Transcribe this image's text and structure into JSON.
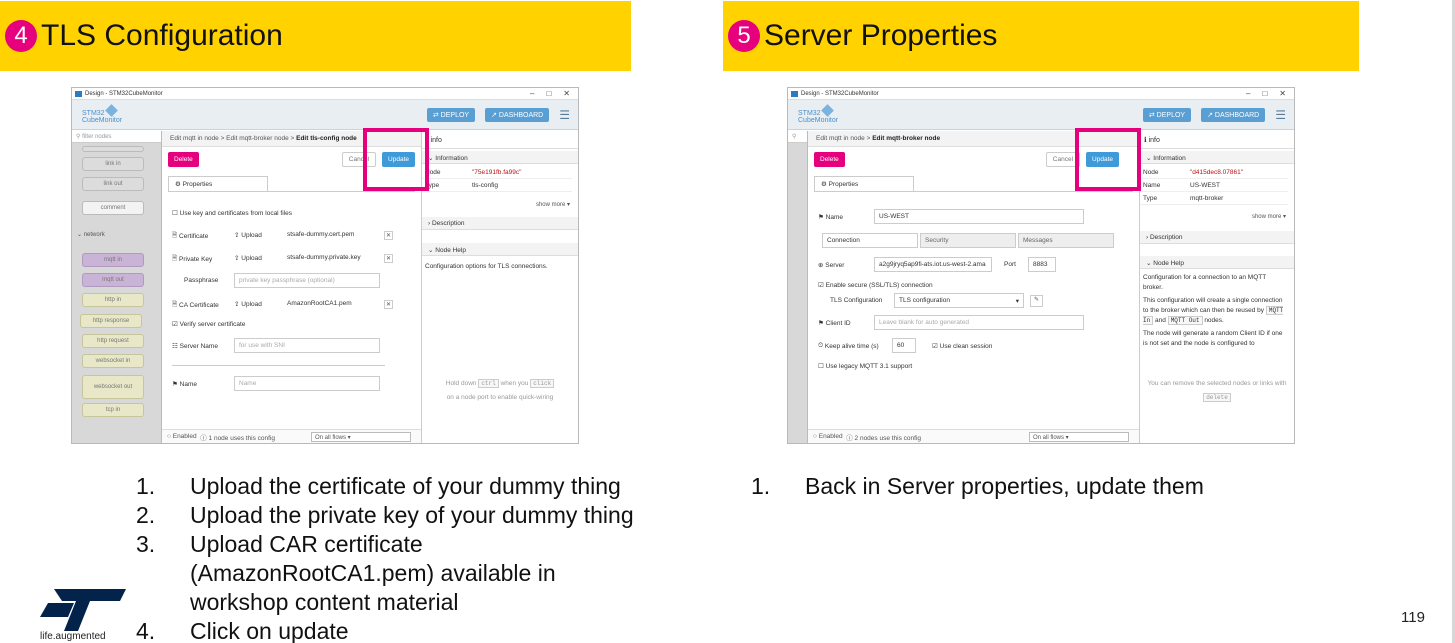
{
  "left": {
    "badge": "4",
    "title": "TLS Configuration",
    "window": {
      "title": "Design - STM32CubeMonitor",
      "logo_line1": "STM32",
      "logo_line2": "CubeMonitor",
      "deploy": "DEPLOY",
      "dashboard": "DASHBOARD",
      "filter": "filter nodes",
      "palette": [
        "link in",
        "link out",
        "comment",
        "network",
        "mqtt in",
        "mqtt out",
        "http in",
        "http response",
        "http request",
        "websocket in",
        "websocket out",
        "tcp in"
      ],
      "breadcrumb_prefix": "Edit mqtt in node > Edit mqtt-broker node > ",
      "breadcrumb_current": "Edit tls-config node",
      "delete": "Delete",
      "cancel": "Cancel",
      "update": "Update",
      "properties_tab": "Properties",
      "use_local": "Use key and certificates from local files",
      "cert_label": "Certificate",
      "upload": "Upload",
      "cert_file": "stsafe-dummy.cert.pem",
      "key_label": "Private Key",
      "key_file": "stsafe-dummy.private.key",
      "pass_label": "Passphrase",
      "pass_placeholder": "private key passphrase (optional)",
      "ca_label": "CA Certificate",
      "ca_file": "AmazonRootCA1.pem",
      "verify": "Verify server certificate",
      "servername_label": "Server Name",
      "servername_placeholder": "for use with SNI",
      "name_label": "Name",
      "name_placeholder": "Name",
      "enabled": "Enabled",
      "usage": "1 node uses this config",
      "flows": "On all flows",
      "info_tab": "info",
      "information": "Information",
      "node_key": "Node",
      "node_val": "\"75e191fb.fa99c\"",
      "type_key": "Type",
      "type_val": "tls-config",
      "show_more": "show more",
      "description": "Description",
      "node_help": "Node Help",
      "help_text": "Configuration options for TLS connections.",
      "hint_a": "Hold down",
      "hint_key1": "ctrl",
      "hint_b": "when you",
      "hint_key2": "click",
      "hint_c": "on a node port to enable quick-wiring"
    },
    "steps": [
      {
        "n": "1.",
        "text": "Upload the certificate of your dummy thing"
      },
      {
        "n": "2.",
        "text": "Upload the private key of your dummy thing"
      },
      {
        "n": "3.",
        "text": "Upload CAR certificate (AmazonRootCA1.pem) available in workshop content material"
      },
      {
        "n": "4.",
        "text": "Click on update"
      }
    ]
  },
  "right": {
    "badge": "5",
    "title": "Server Properties",
    "window": {
      "title": "Design - STM32CubeMonitor",
      "breadcrumb_prefix": "Edit mqtt in node > ",
      "breadcrumb_current": "Edit mqtt-broker node",
      "delete": "Delete",
      "cancel": "Cancel",
      "update": "Update",
      "properties_tab": "Properties",
      "name_label": "Name",
      "name_value": "US-WEST",
      "tab_connection": "Connection",
      "tab_security": "Security",
      "tab_messages": "Messages",
      "server_label": "Server",
      "server_value": "a2g9jryq5ap9fi-ats.iot.us-west-2.ama",
      "port_label": "Port",
      "port_value": "8883",
      "enable_tls": "Enable secure (SSL/TLS) connection",
      "tls_config_label": "TLS Configuration",
      "tls_config_value": "TLS configuration",
      "client_id_label": "Client ID",
      "client_id_placeholder": "Leave blank for auto generated",
      "keepalive_label": "Keep alive time (s)",
      "keepalive_value": "60",
      "clean_session": "Use clean session",
      "legacy": "Use legacy MQTT 3.1 support",
      "enabled": "Enabled",
      "usage": "2 nodes use this config",
      "flows": "On all flows",
      "info_tab": "info",
      "information": "Information",
      "node_key": "Node",
      "node_val": "\"d415dec8.07861\"",
      "name_key": "Name",
      "name_val": "US-WEST",
      "type_key": "Type",
      "type_val": "mqtt-broker",
      "show_more": "show more",
      "description": "Description",
      "node_help": "Node Help",
      "help1": "Configuration for a connection to an MQTT broker.",
      "help2a": "This configuration will create a single connection to the broker which can then be reused by",
      "help2_code1": "MQTT In",
      "help2_and": "and",
      "help2_code2": "MQTT Out",
      "help2b": "nodes.",
      "help3": "The node will generate a random Client ID if one is not set and the node is configured to",
      "hint_a": "You can remove the selected nodes or links with",
      "hint_key": "delete"
    },
    "steps": [
      {
        "n": "1.",
        "text": "Back in Server properties, update them"
      }
    ]
  },
  "footer": {
    "tagline": "life.augmented",
    "page_number": "119"
  },
  "colors": {
    "banner": "#ffd200",
    "badge": "#e6007e",
    "highlight": "#e6007e",
    "update_button": "#3e9ad9"
  }
}
